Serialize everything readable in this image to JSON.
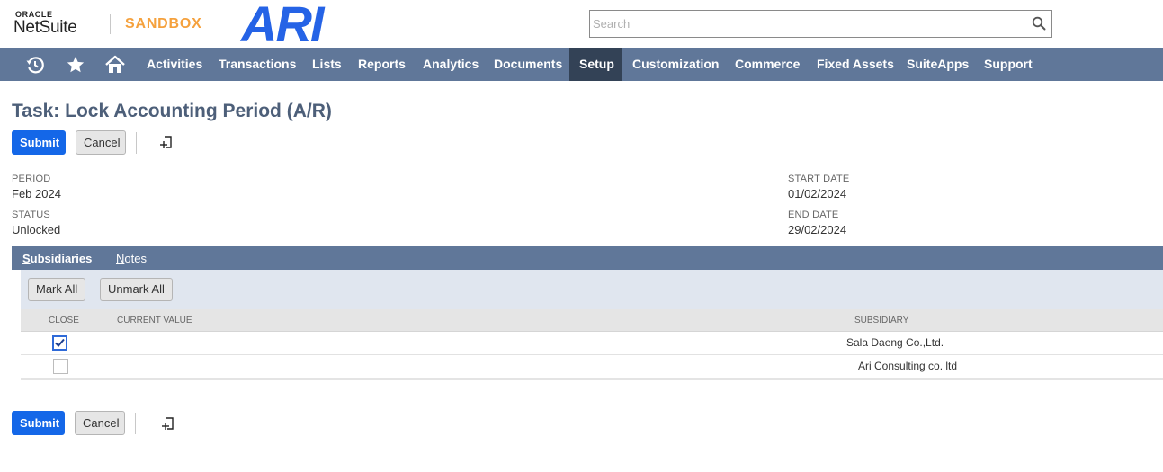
{
  "header": {
    "oracle": "ORACLE",
    "netsuite": "NetSuite",
    "sandbox": "SANDBOX",
    "company_logo": "ARI",
    "search_placeholder": "Search"
  },
  "nav": {
    "items": [
      "Activities",
      "Transactions",
      "Lists",
      "Reports",
      "Analytics",
      "Documents",
      "Setup",
      "Customization",
      "Commerce",
      "Fixed Assets",
      "SuiteApps",
      "Support"
    ],
    "active": "Setup"
  },
  "page": {
    "title": "Task: Lock Accounting Period (A/R)",
    "submit_label": "Submit",
    "cancel_label": "Cancel"
  },
  "fields": {
    "period_label": "PERIOD",
    "period_value": "Feb 2024",
    "status_label": "STATUS",
    "status_value": "Unlocked",
    "start_date_label": "START DATE",
    "start_date_value": "01/02/2024",
    "end_date_label": "END DATE",
    "end_date_value": "29/02/2024"
  },
  "subtabs": {
    "subsidiaries_first": "S",
    "subsidiaries_rest": "ubsidiaries",
    "notes_first": "N",
    "notes_rest": "otes"
  },
  "sublist": {
    "mark_all": "Mark All",
    "unmark_all": "Unmark All",
    "columns": [
      "CLOSE",
      "CURRENT VALUE",
      "SUBSIDIARY"
    ],
    "rows": [
      {
        "close": true,
        "current_value": "",
        "subsidiary": "Sala Daeng Co.,Ltd."
      },
      {
        "close": false,
        "current_value": "",
        "subsidiary": "Ari Consulting co. ltd"
      }
    ]
  },
  "colors": {
    "nav_bg": "#607799",
    "nav_active": "#334256",
    "primary": "#1467e8",
    "sandbox": "#f5a13d",
    "logo": "#2563e6"
  }
}
